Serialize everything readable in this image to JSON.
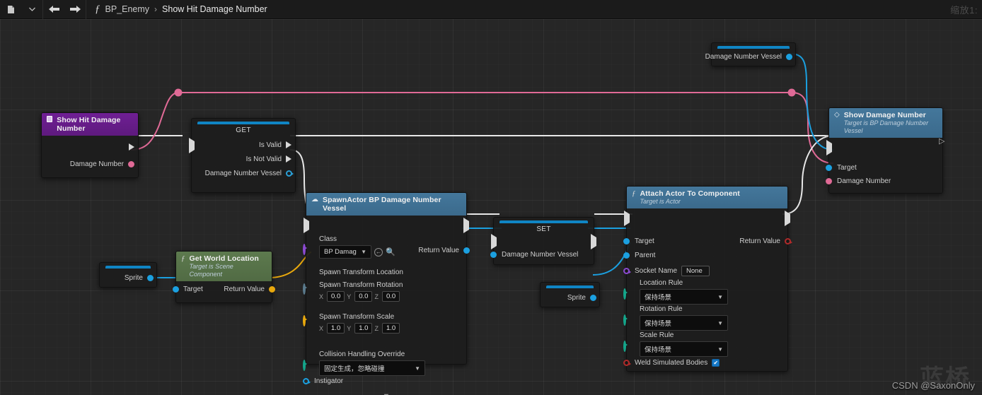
{
  "toolbar": {
    "blueprint_icon": "blueprint-icon",
    "dropdown_icon": "chevron-down-icon",
    "back_icon": "arrow-left-icon",
    "forward_icon": "arrow-right-icon",
    "function_icon": "function-fx-icon",
    "breadcrumb": {
      "root": "BP_Enemy",
      "separator": "›",
      "current": "Show Hit Damage Number"
    },
    "zoom_label": "缩放1:"
  },
  "watermark": {
    "text": "CSDN @SaxonOnly",
    "backdrop": "蓝桥"
  },
  "colors": {
    "exec_wire": "#e8e8e8",
    "object_wire": "#1ba0e0",
    "int_wire": "#e06a96",
    "vector_wire": "#e8a80d",
    "node_header_function": "#44779b",
    "node_header_event": "#6f1f94",
    "node_header_pure": "#5d7a4e",
    "variable_bar": "#1085c4",
    "canvas": "#262626"
  },
  "nodes": {
    "event": {
      "title": "Show Hit Damage Number",
      "icon": "event-node-icon",
      "exec_out": "exec-out-pin",
      "outputs": [
        {
          "label": "Damage Number",
          "type": "int",
          "pin": "pin-damage-number"
        }
      ]
    },
    "isvalid": {
      "title": "GET",
      "exec_in": "exec-in-pin",
      "outputs": [
        {
          "label": "Is Valid",
          "type": "exec"
        },
        {
          "label": "Is Not Valid",
          "type": "exec"
        },
        {
          "label": "Damage Number Vessel",
          "type": "object"
        }
      ]
    },
    "getworldlocation": {
      "title": "Get World Location",
      "subtitle": "Target is Scene Component",
      "icon": "function-fx-icon",
      "inputs": [
        {
          "label": "Target",
          "type": "object"
        }
      ],
      "outputs": [
        {
          "label": "Return Value",
          "type": "vector"
        }
      ]
    },
    "sprite_left": {
      "label": "Sprite",
      "type": "object"
    },
    "sprite_right": {
      "label": "Sprite",
      "type": "object"
    },
    "spawnactor": {
      "title": "SpawnActor BP Damage Number Vessel",
      "icon": "spawn-actor-icon",
      "class_label": "Class",
      "class_value": "BP Damage Nu",
      "class_browse_icon": "browse-icon",
      "class_search_icon": "search-icon",
      "rows": [
        {
          "label": "Spawn Transform Location",
          "type": "vector-dot"
        },
        {
          "label": "Spawn Transform Rotation",
          "type": "rotator",
          "x": "0.0",
          "y": "0.0",
          "z": "0.0"
        },
        {
          "label": "Spawn Transform Scale",
          "type": "vector",
          "x": "1.0",
          "y": "1.0",
          "z": "1.0"
        },
        {
          "label": "Collision Handling Override",
          "type": "enum",
          "value": "固定生成，忽略碰撞"
        },
        {
          "label": "Instigator",
          "type": "object"
        }
      ],
      "axis_x": "X",
      "axis_y": "Y",
      "axis_z": "Z",
      "expand_icon": "chevron-down-icon",
      "output": {
        "label": "Return Value",
        "type": "object"
      }
    },
    "set": {
      "title": "SET",
      "input": {
        "label": "Damage Number Vessel",
        "type": "object"
      }
    },
    "attach": {
      "title": "Attach Actor To Component",
      "subtitle": "Target is Actor",
      "icon": "function-fx-icon",
      "inputs": [
        {
          "label": "Target",
          "type": "object"
        },
        {
          "label": "Parent",
          "type": "object"
        },
        {
          "label": "Socket Name",
          "type": "name",
          "value": "None"
        }
      ],
      "rules": [
        {
          "label": "Location Rule",
          "value": "保持场景"
        },
        {
          "label": "Rotation Rule",
          "value": "保持场景"
        },
        {
          "label": "Scale Rule",
          "value": "保持场景"
        }
      ],
      "weld": {
        "label": "Weld Simulated Bodies",
        "checked": true,
        "check_glyph": "✔"
      },
      "output": {
        "label": "Return Value",
        "type": "bool"
      }
    },
    "vessel_var": {
      "label": "Damage Number Vessel",
      "type": "object"
    },
    "showdamage": {
      "title": "Show Damage Number",
      "subtitle": "Target is BP Damage Number Vessel",
      "icon": "blueprint-event-icon",
      "inputs": [
        {
          "label": "Target",
          "type": "object"
        },
        {
          "label": "Damage Number",
          "type": "int"
        }
      ]
    }
  }
}
